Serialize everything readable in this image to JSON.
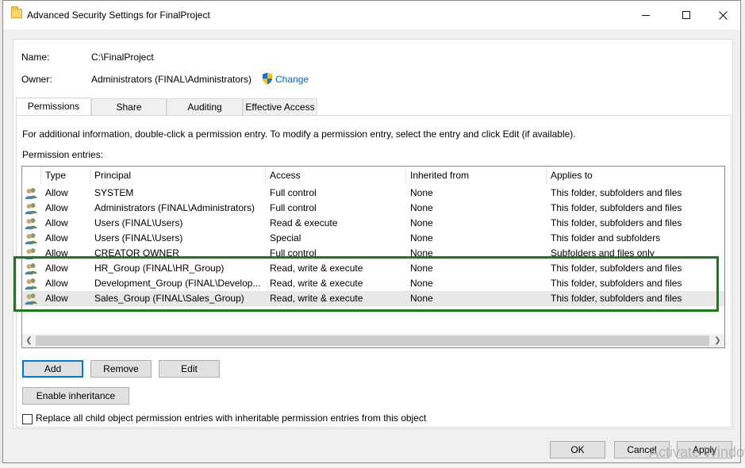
{
  "window": {
    "title": "Advanced Security Settings for FinalProject"
  },
  "info": {
    "name_label": "Name:",
    "name_value": "C:\\FinalProject",
    "owner_label": "Owner:",
    "owner_value": "Administrators (FINAL\\Administrators)",
    "change_link": "Change"
  },
  "tabs": [
    {
      "label": "Permissions"
    },
    {
      "label": "Share"
    },
    {
      "label": "Auditing"
    },
    {
      "label": "Effective Access"
    }
  ],
  "permissions": {
    "instructions": "For additional information, double-click a permission entry. To modify a permission entry, select the entry and click Edit (if available).",
    "entries_label": "Permission entries:",
    "columns": [
      "Type",
      "Principal",
      "Access",
      "Inherited from",
      "Applies to"
    ],
    "rows": [
      {
        "type": "Allow",
        "principal": "SYSTEM",
        "access": "Full control",
        "inherited": "None",
        "applies": "This folder, subfolders and files"
      },
      {
        "type": "Allow",
        "principal": "Administrators (FINAL\\Administrators)",
        "access": "Full control",
        "inherited": "None",
        "applies": "This folder, subfolders and files"
      },
      {
        "type": "Allow",
        "principal": "Users (FINAL\\Users)",
        "access": "Read & execute",
        "inherited": "None",
        "applies": "This folder, subfolders and files"
      },
      {
        "type": "Allow",
        "principal": "Users (FINAL\\Users)",
        "access": "Special",
        "inherited": "None",
        "applies": "This folder and subfolders"
      },
      {
        "type": "Allow",
        "principal": "CREATOR OWNER",
        "access": "Full control",
        "inherited": "None",
        "applies": "Subfolders and files only"
      },
      {
        "type": "Allow",
        "principal": "HR_Group (FINAL\\HR_Group)",
        "access": "Read, write & execute",
        "inherited": "None",
        "applies": "This folder, subfolders and files"
      },
      {
        "type": "Allow",
        "principal": "Development_Group (FINAL\\Develop...",
        "access": "Read, write & execute",
        "inherited": "None",
        "applies": "This folder, subfolders and files"
      },
      {
        "type": "Allow",
        "principal": "Sales_Group (FINAL\\Sales_Group)",
        "access": "Read, write & execute",
        "inherited": "None",
        "applies": "This folder, subfolders and files"
      }
    ],
    "buttons": {
      "add": "Add",
      "remove": "Remove",
      "edit": "Edit"
    },
    "enable_inheritance": "Enable inheritance",
    "replace_checkbox_label": "Replace all child object permission entries with inheritable permission entries from this object",
    "replace_checked": false
  },
  "footer": {
    "ok": "OK",
    "cancel": "Cancel",
    "apply": "Apply"
  },
  "watermark": "Activate Windows",
  "colors": {
    "highlight": "#1b7a1b",
    "link": "#0066cc",
    "default_button_border": "#0078d7"
  }
}
